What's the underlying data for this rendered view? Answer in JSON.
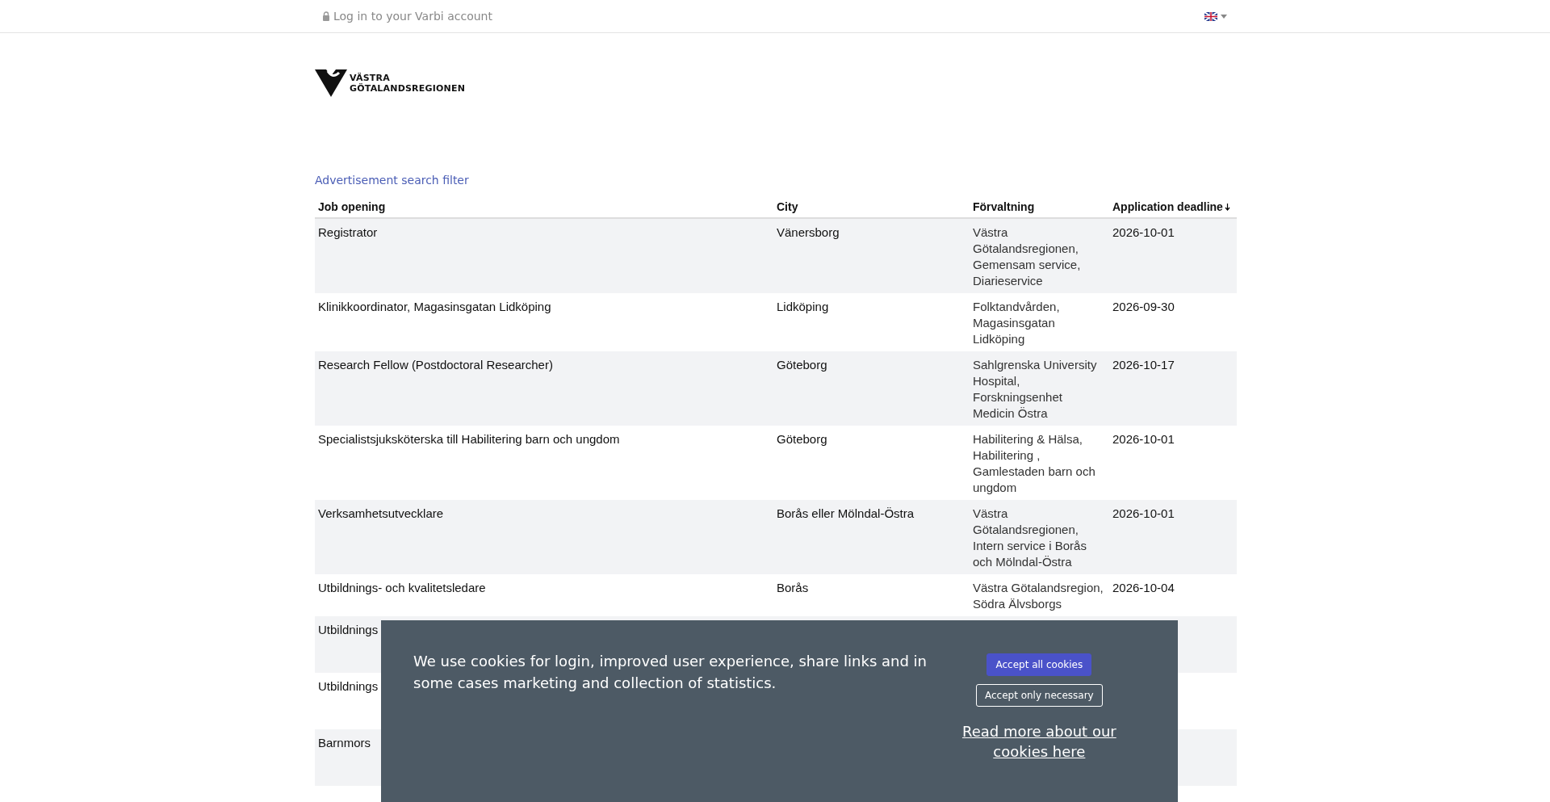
{
  "top_bar": {
    "login_link": "Log in to your Varbi account"
  },
  "logo": {
    "line_1": "VÄSTRA",
    "line_2": "GÖTALANDSREGIONEN"
  },
  "search_filter_link": "Advertisement search filter",
  "table": {
    "columns": [
      {
        "label": "Job opening",
        "sorted": false
      },
      {
        "label": "City",
        "sorted": false
      },
      {
        "label": "Förvaltning",
        "sorted": false
      },
      {
        "label": "Application deadline",
        "sorted": true
      }
    ],
    "rows": [
      {
        "job": "Registrator",
        "city": "Vänersborg",
        "administration": "Västra Götalandsregionen, Gemensam service, Diarieservice",
        "deadline": "2026-10-01"
      },
      {
        "job": "Klinikkoordinator, Magasinsgatan Lidköping",
        "city": "Lidköping",
        "administration": "Folktandvården, Magasinsgatan Lidköping",
        "deadline": "2026-09-30"
      },
      {
        "job": "Research Fellow (Postdoctoral Researcher)",
        "city": "Göteborg",
        "administration": "Sahlgrenska University Hospital, Forskningsenhet Medicin Östra",
        "deadline": "2026-10-17"
      },
      {
        "job": "Specialistsjuksköterska till Habilitering barn och ungdom",
        "city": "Göteborg",
        "administration": "Habilitering & Hälsa, Habilitering , Gamlestaden barn och ungdom",
        "deadline": "2026-10-01"
      },
      {
        "job": "Verksamhetsutvecklare",
        "city": "Borås eller Mölndal-Östra",
        "administration": "Västra Götalandsregionen, Intern service i Borås och Mölndal-Östra",
        "deadline": "2026-10-01"
      },
      {
        "job": "Utbildnings- och kvalitetsledare",
        "city": "Borås",
        "administration": "Västra Götalandsregion, Södra Älvsborgs",
        "deadline": "2026-10-04"
      }
    ],
    "rows_under_banner": [
      {
        "job": "Utbildnings"
      },
      {
        "job": "Utbildnings"
      },
      {
        "job": "Barnmors"
      }
    ]
  },
  "cookie_banner": {
    "message": "We use cookies for login, improved user experience, share links and in some cases marketing and collection of statistics.",
    "buttons": [
      {
        "label": "Accept all cookies",
        "kind": "primary"
      },
      {
        "label": "Accept only necessary",
        "kind": "outline"
      }
    ],
    "read_more_link": "Read more about our cookies here"
  }
}
